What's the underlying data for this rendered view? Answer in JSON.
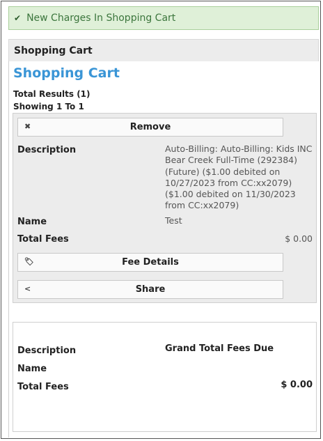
{
  "alert": {
    "icon": "check-icon",
    "text": "New Charges In Shopping Cart"
  },
  "panel": {
    "header": "Shopping Cart"
  },
  "page": {
    "title": "Shopping Cart",
    "total_results": "Total Results (1)",
    "showing": "Showing 1 To 1"
  },
  "item": {
    "remove_label": "Remove",
    "description_label": "Description",
    "description_value": "Auto-Billing: Auto-Billing: Kids INC Bear Creek Full-Time (292384) (Future) ($1.00 debited on 10/27/2023 from CC:xx2079) ($1.00 debited on 11/30/2023 from CC:xx2079)",
    "name_label": "Name",
    "name_value": "Test",
    "total_fees_label": "Total Fees",
    "total_fees_value": "$ 0.00",
    "fee_details_label": "Fee Details",
    "share_label": "Share"
  },
  "summary": {
    "description_label": "Description",
    "description_value": "Grand Total Fees Due",
    "name_label": "Name",
    "total_fees_label": "Total Fees",
    "total_fees_value": "$ 0.00"
  },
  "colors": {
    "accent": "#3a95d6",
    "alert_bg": "#dff0d8",
    "alert_text": "#3c763d",
    "panel_bg": "#ececec"
  }
}
